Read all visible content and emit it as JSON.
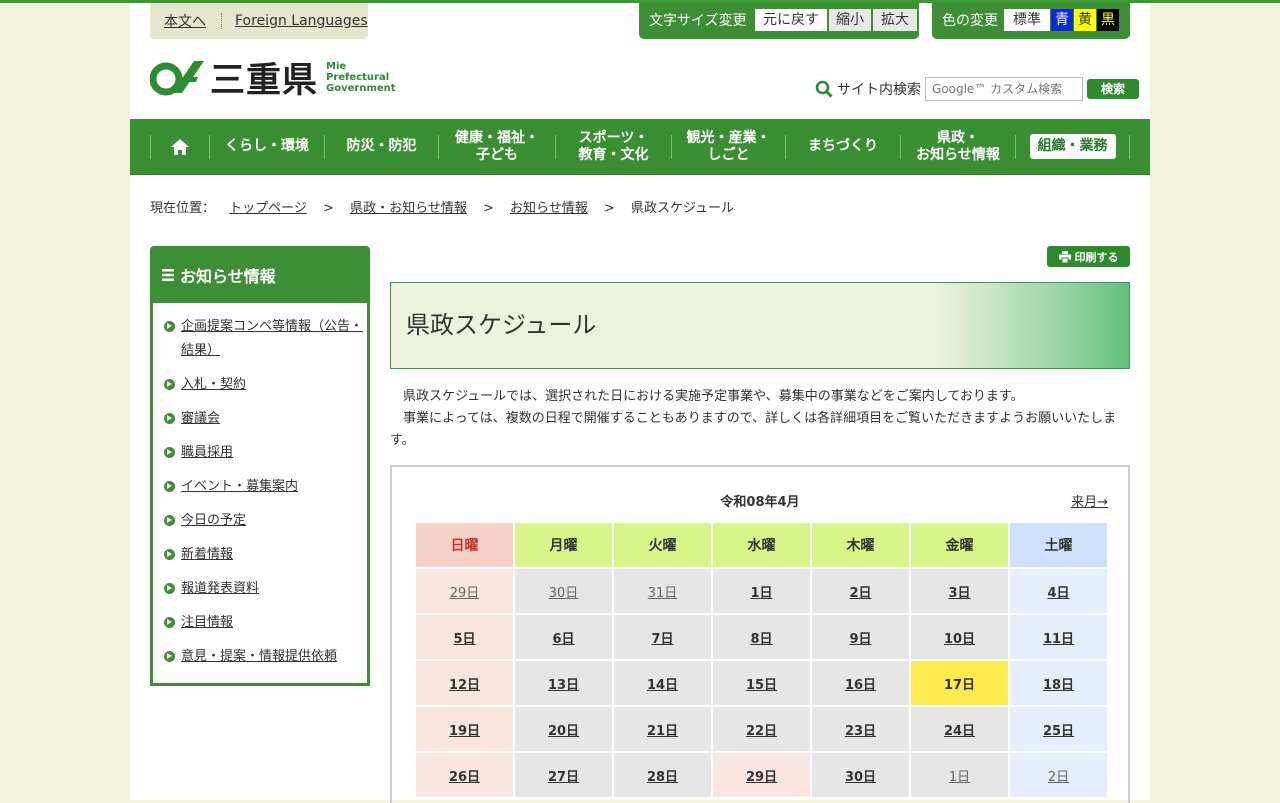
{
  "utility": {
    "skip_link": "本文へ",
    "foreign_link": "Foreign Languages",
    "font_size_label": "文字サイズ変更",
    "font_reset": "元に戻す",
    "font_smaller": "縮小",
    "font_larger": "拡大",
    "color_label": "色の変更",
    "color_standard": "標準",
    "color_blue": "青",
    "color_yellow": "黄",
    "color_black": "黒"
  },
  "logo": {
    "kanji": "三重県",
    "en1": "Mie",
    "en2": "Prefectural",
    "en3": "Government"
  },
  "search": {
    "label": "サイト内検索",
    "placeholder": "Google™ カスタム検索",
    "button": "検索"
  },
  "nav": {
    "home": "home-icon",
    "items": [
      "くらし・環境",
      "防災・防犯",
      "健康・福祉・\n子ども",
      "スポーツ・\n教育・文化",
      "観光・産業・\nしごと",
      "まちづくり",
      "県政・\nお知らせ情報",
      "組織・業務"
    ]
  },
  "breadcrumb": {
    "prefix": "現在位置：",
    "items": [
      "トップページ",
      "県政・お知らせ情報",
      "お知らせ情報",
      "県政スケジュール"
    ],
    "separator": ">"
  },
  "sidebar": {
    "title": "お知らせ情報",
    "items": [
      "企画提案コンペ等情報（公告・結果）",
      "入札・契約",
      "審議会",
      "職員採用",
      "イベント・募集案内",
      "今日の予定",
      "新着情報",
      "報道発表資料",
      "注目情報",
      "意見・提案・情報提供依頼"
    ]
  },
  "print_button": "印刷する",
  "page_title": "県政スケジュール",
  "intro": {
    "p1": "県政スケジュールでは、選択された日における実施予定事業や、募集中の事業などをご案内しております。",
    "p2": "事業によっては、複数の日程で開催することもありますので、詳しくは各詳細項目をご覧いただきますようお願いいたします。"
  },
  "calendar": {
    "month": "令和08年4月",
    "next": "来月→",
    "weekdays": [
      "日曜",
      "月曜",
      "火曜",
      "水曜",
      "木曜",
      "金曜",
      "土曜"
    ],
    "weeks": [
      [
        "29日",
        "30日",
        "31日",
        "1日",
        "2日",
        "3日",
        "4日"
      ],
      [
        "5日",
        "6日",
        "7日",
        "8日",
        "9日",
        "10日",
        "11日"
      ],
      [
        "12日",
        "13日",
        "14日",
        "15日",
        "16日",
        "17日",
        "18日"
      ],
      [
        "19日",
        "20日",
        "21日",
        "22日",
        "23日",
        "24日",
        "25日"
      ],
      [
        "26日",
        "27日",
        "28日",
        "29日",
        "30日",
        "1日",
        "2日"
      ]
    ],
    "today": "17日",
    "holiday": "29日"
  },
  "colors": {
    "brand_green": "#3c8f35",
    "today": "#ffeb4f",
    "sunday": "#c8322b"
  }
}
